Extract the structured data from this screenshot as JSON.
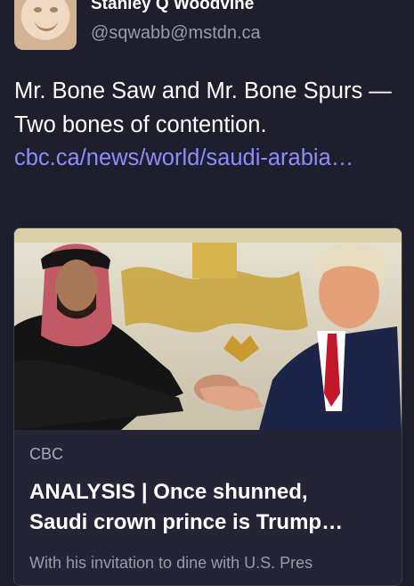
{
  "author": {
    "display_name": "Stanley Q Woodvine",
    "handle": "@sqwabb@mstdn.ca",
    "avatar_icon": "avatar-face-icon"
  },
  "post": {
    "text": "Mr. Bone Saw and Mr. Bone Spurs — Two bones of contention. ",
    "link_text": "cbc.ca/news/world/saudi-arabia…"
  },
  "link_card": {
    "source": "CBC",
    "title_line1": "ANALYSIS | Once shunned,",
    "title_line2": "Saudi crown prince is Trump…",
    "description": "With his invitation to dine with U.S. Pres",
    "image_alt": "Saudi crown prince and Trump shaking hands"
  },
  "colors": {
    "background": "#1f1e2d",
    "link": "#8c8dff",
    "muted_text": "#9b9aa9"
  }
}
